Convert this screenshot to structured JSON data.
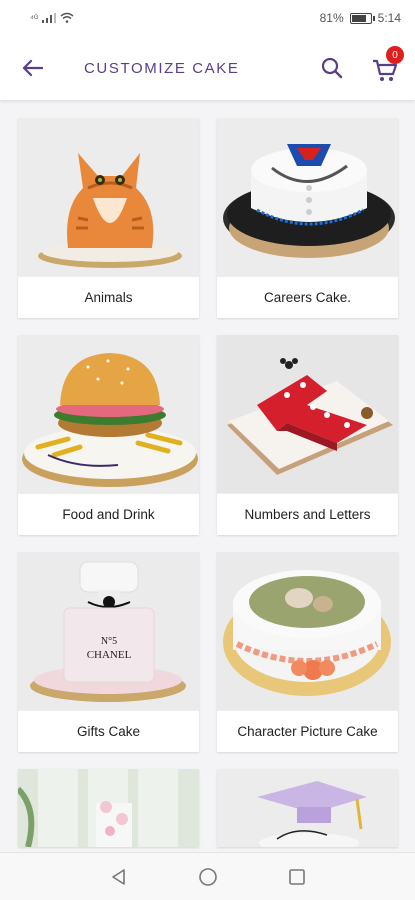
{
  "status_bar": {
    "signal": "⁴ᴳ",
    "battery_percent": "81%",
    "battery_level": 0.81,
    "time": "5:14"
  },
  "app_bar": {
    "title": "CUSTOMIZE CAKE",
    "cart_count": "0"
  },
  "colors": {
    "accent": "#5a3d8a",
    "badge": "#e01e1e"
  },
  "categories": [
    {
      "label": "Animals",
      "image": "orange-cat-cake"
    },
    {
      "label": "Careers Cake.",
      "image": "doctor-coat-cake"
    },
    {
      "label": "Food and Drink",
      "image": "burger-cake"
    },
    {
      "label": "Numbers and Letters",
      "image": "number-one-minnie-cake"
    },
    {
      "label": "Gifts Cake",
      "image": "chanel-perfume-cake"
    },
    {
      "label": "Character Picture Cake",
      "image": "photo-print-cake"
    },
    {
      "label": "",
      "image": "floral-tier-cake"
    },
    {
      "label": "",
      "image": "graduation-cap-cake"
    }
  ],
  "nav": {
    "back": "back-icon",
    "home": "home-icon",
    "recents": "recents-icon"
  }
}
